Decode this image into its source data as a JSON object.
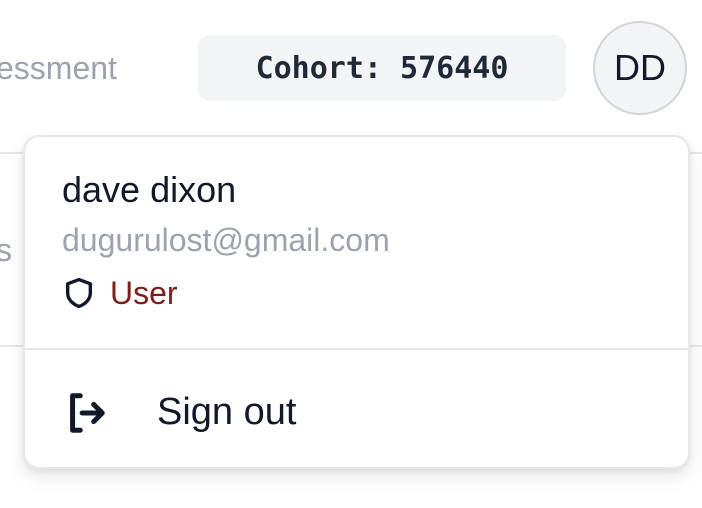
{
  "header": {
    "nav_partial_text": "essment",
    "cohort_badge": "Cohort: 576440",
    "avatar_initials": "DD"
  },
  "background": {
    "side_partial_text": "s"
  },
  "user_menu": {
    "name": "dave dixon",
    "email": "dugurulost@gmail.com",
    "role": "User",
    "role_icon": "shield-icon",
    "sign_out_label": "Sign out",
    "sign_out_icon": "sign-out-icon"
  },
  "colors": {
    "role_text": "#7f1d1d",
    "muted_text": "#9ca3af",
    "badge_bg": "#f3f4f6"
  }
}
